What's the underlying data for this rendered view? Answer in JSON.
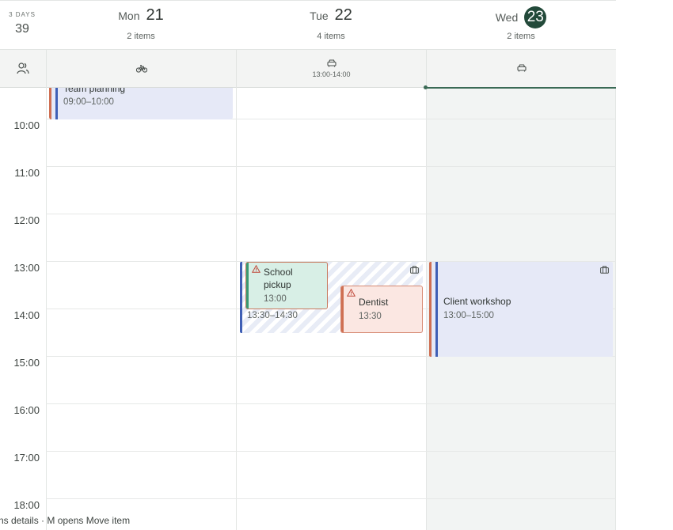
{
  "header": {
    "span_label": "3 DAYS",
    "week_number": "39",
    "days": [
      {
        "dow": "Mon",
        "date": "21",
        "count": "2 items",
        "today": false
      },
      {
        "dow": "Tue",
        "date": "22",
        "count": "4 items",
        "today": false
      },
      {
        "dow": "Wed",
        "date": "23",
        "count": "2 items",
        "today": true
      }
    ]
  },
  "strip": {
    "people_icon": "people-icon",
    "mon_icon": "bicycle-icon",
    "tue_icon": "car-icon",
    "tue_time": "13:00-14:00",
    "wed_icon": "car-icon"
  },
  "hours": [
    "10:00",
    "11:00",
    "12:00",
    "13:00",
    "14:00",
    "15:00",
    "16:00",
    "17:00",
    "18:00"
  ],
  "events": {
    "team_planning": {
      "title": "Team planning",
      "time": "09:00–10:00"
    },
    "school_pickup": {
      "title": "School pickup",
      "time": "13:00",
      "icon": "warning-icon"
    },
    "tue_block": {
      "time": "13:30–14:30",
      "icon": "briefcase-icon"
    },
    "dentist": {
      "title": "Dentist",
      "time": "13:30",
      "icon": "warning-icon"
    },
    "client_workshop": {
      "title": "Client workshop",
      "time": "13:00–15:00",
      "icon": "briefcase-icon"
    }
  },
  "colors": {
    "accent_blue": "#3f5fb5",
    "accent_orange": "#cf6f52",
    "accent_green": "#3a9a72",
    "today_badge": "#234a3a"
  },
  "status_bar": "ns details · M opens Move item"
}
